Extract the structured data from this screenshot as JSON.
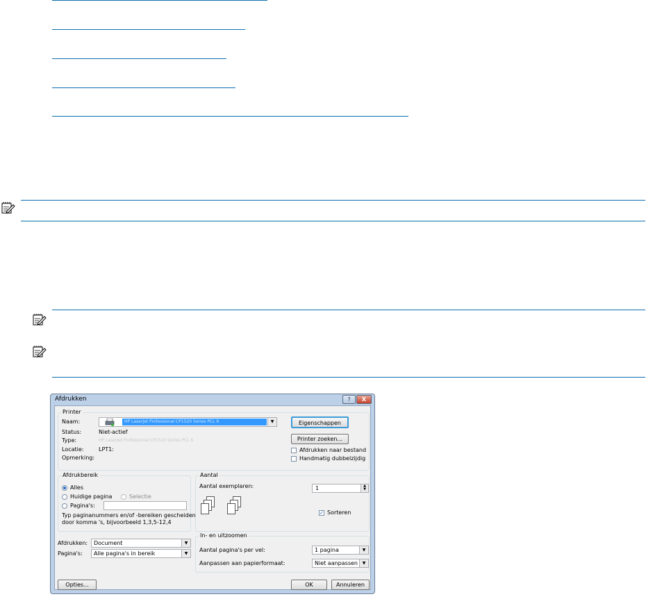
{
  "dialog": {
    "title": "Afdrukken",
    "help_button": "?",
    "close_button": "X",
    "printer_group": {
      "label": "Printer",
      "name_label": "Naam:",
      "printer_name": "HP LaserJet Professional CP1520 Series PCL 6",
      "status_label": "Status:",
      "status_value": "Niet-actief",
      "type_label": "Type:",
      "type_value": "HP LaserJet Professional CP1520 Series PCL 6",
      "location_label": "Locatie:",
      "location_value": "LPT1:",
      "comment_label": "Opmerking:",
      "properties_button": "Eigenschappen",
      "find_printer_button": "Printer zoeken...",
      "print_to_file_label": "Afdrukken naar bestand",
      "manual_duplex_label": "Handmatig dubbelzijdig"
    },
    "range_group": {
      "label": "Afdrukbereik",
      "all_label": "Alles",
      "current_page_label": "Huidige pagina",
      "selection_label": "Selectie",
      "pages_label": "Pagina's:",
      "pages_value": "",
      "hint_line1": "Typ paginanummers en/of -bereiken gescheiden",
      "hint_line2": "door komma 's, bijvoorbeeld 1,3,5-12,4"
    },
    "copies_group": {
      "label": "Aantal",
      "copies_label": "Aantal exemplaren:",
      "copies_value": "1",
      "collate_label": "Sorteren"
    },
    "print_what_label": "Afdrukken:",
    "print_what_value": "Document",
    "pages_select_label": "Pagina's:",
    "pages_select_value": "Alle pagina's in bereik",
    "zoom_group": {
      "label": "In- en uitzoomen",
      "pages_per_sheet_label": "Aantal pagina's per vel:",
      "pages_per_sheet_value": "1 pagina",
      "scale_label": "Aanpassen aan papierformaat:",
      "scale_value": "Niet aanpassen"
    },
    "options_button": "Opties...",
    "ok_button": "OK",
    "cancel_button": "Annuleren"
  }
}
